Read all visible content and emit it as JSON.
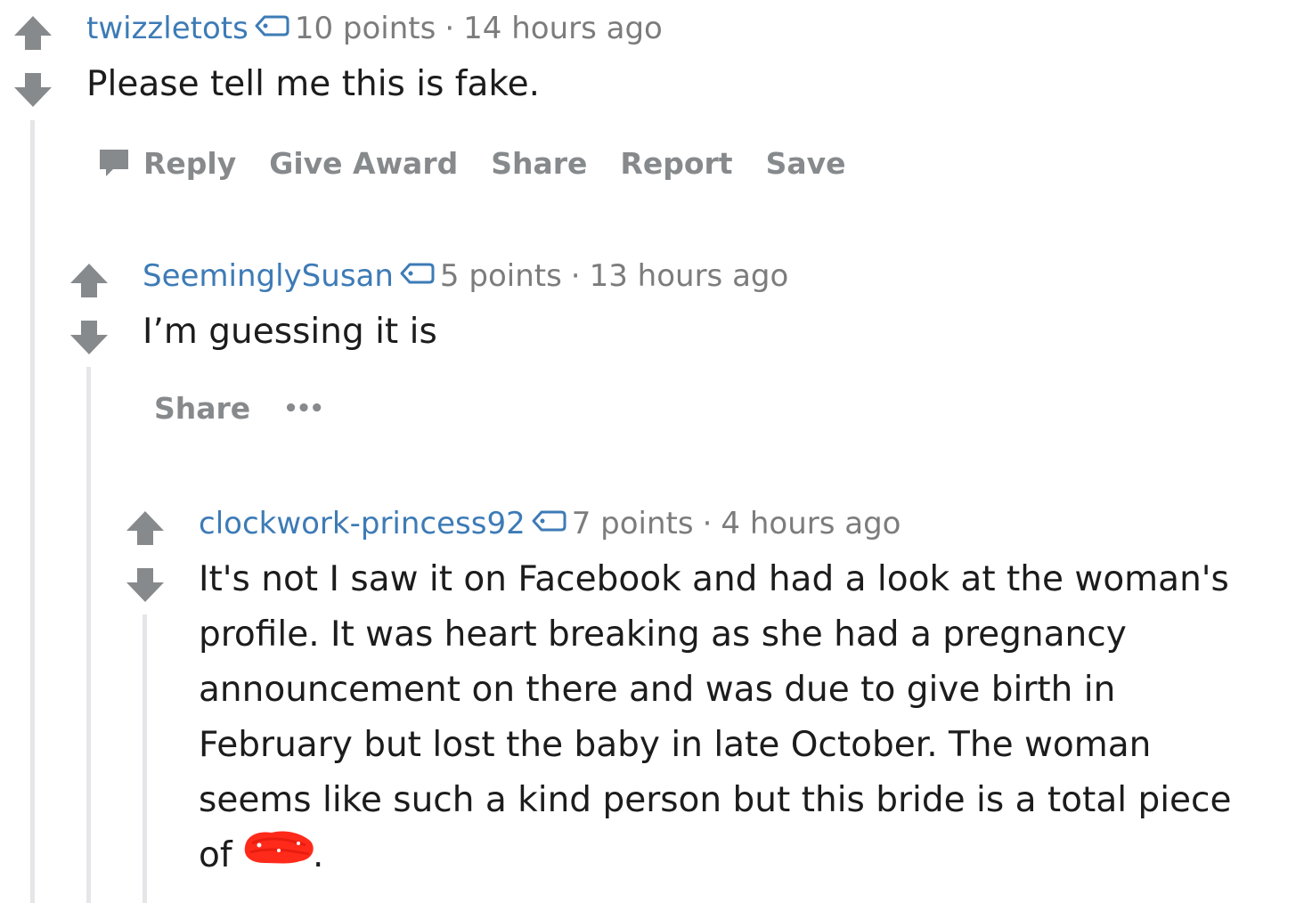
{
  "colors": {
    "author": "#3d7bb6",
    "meta": "#7c7c7c",
    "action": "#878a8c",
    "vote_arrow": "#878a8c",
    "thread_line": "#e4e6e8",
    "censor_red": "#ff2a1a"
  },
  "comments": [
    {
      "author": "twizzletots",
      "points": "10 points",
      "separator": "·",
      "time": "14 hours ago",
      "body": "Please tell me this is fake.",
      "actions": [
        "Reply",
        "Give Award",
        "Share",
        "Report",
        "Save"
      ]
    },
    {
      "author": "SeeminglySusan",
      "points": "5 points",
      "separator": "·",
      "time": "13 hours ago",
      "body": "I’m guessing it is",
      "actions": [
        "Share",
        "•••"
      ]
    },
    {
      "author": "clockwork-princess92",
      "points": "7 points",
      "separator": "·",
      "time": "4 hours ago",
      "body_lines": [
        "It's not I saw it on Facebook and had a look at the woman's",
        "profile. It was heart breaking as she had a pregnancy",
        "announcement on there and was due to give birth in",
        "February but lost the baby in late October. The woman",
        "seems like such a kind person but this bride is a total piece"
      ],
      "body_last_prefix": "of ",
      "body_last_suffix": "."
    }
  ],
  "icons": {
    "upvote": "arrow-up-icon",
    "downvote": "arrow-down-icon",
    "flair": "tag-icon",
    "reply": "speech-bubble-icon"
  }
}
